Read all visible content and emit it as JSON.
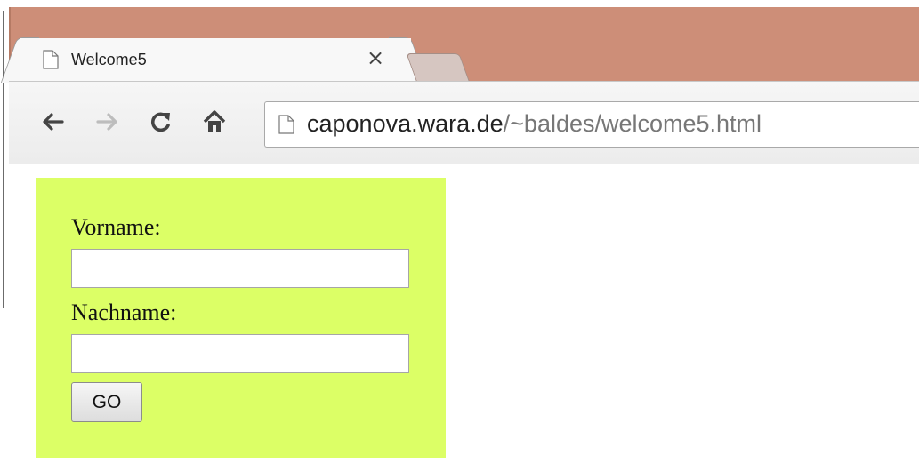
{
  "browser": {
    "tab": {
      "title": "Welcome5",
      "close_label": "×",
      "icon": "page-icon"
    },
    "toolbar": {
      "back_icon": "back-arrow-icon",
      "forward_icon": "forward-arrow-icon",
      "reload_icon": "reload-icon",
      "home_icon": "home-icon"
    },
    "address": {
      "host": "caponova.wara.de",
      "path": "/~baldes/welcome5.html"
    }
  },
  "form": {
    "background": "#dcff66",
    "vorname_label": "Vorname:",
    "vorname_value": "",
    "nachname_label": "Nachname:",
    "nachname_value": "",
    "submit_label": "GO"
  },
  "colors": {
    "frame": "#cd8e78",
    "form_bg": "#dcff66"
  }
}
